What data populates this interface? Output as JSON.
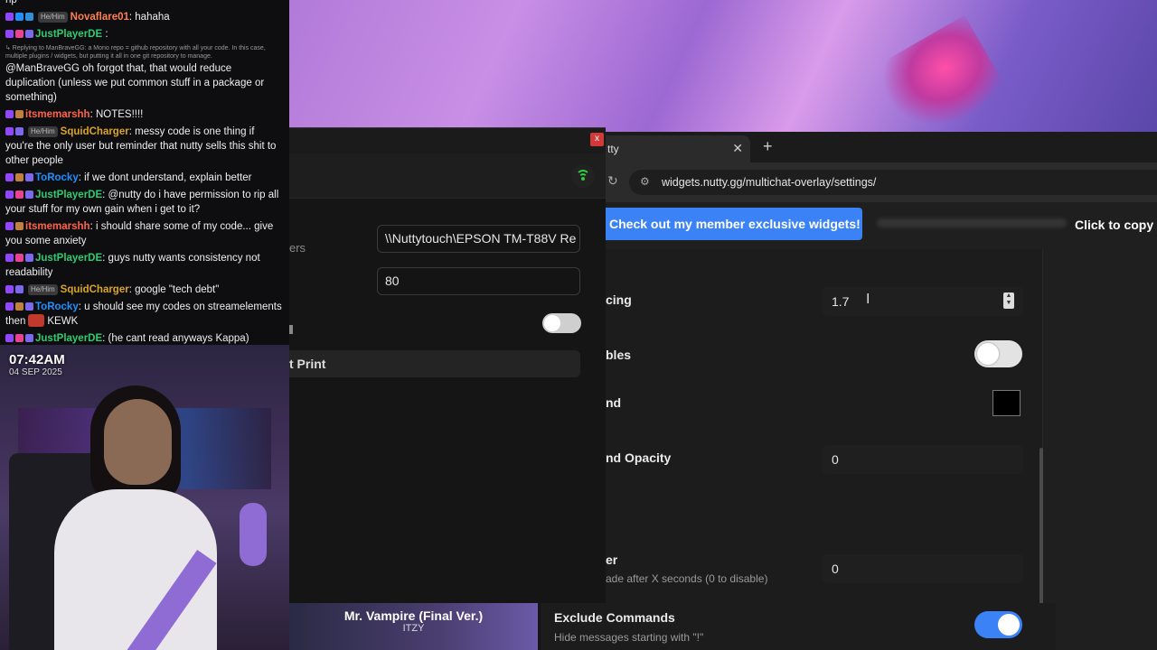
{
  "chat": {
    "messages": [
      {
        "user": "",
        "user_color": "#efeff1",
        "pronoun": "",
        "text": "rip",
        "reply": "",
        "badges": []
      },
      {
        "user": "Novaflare01",
        "user_color": "#ff7f50",
        "pronoun": "He/Him",
        "text": ": hahaha",
        "reply": "",
        "badges": [
          "#9146ff",
          "#1e90ff",
          "#2f8fd8"
        ]
      },
      {
        "user": "JustPlayerDE",
        "user_color": "#2ecc71",
        "pronoun": "",
        "text": " :",
        "reply": "",
        "badges": [
          "#9146ff",
          "#e84393",
          "#7b68ee"
        ]
      },
      {
        "user": "",
        "user_color": "#efeff1",
        "pronoun": "",
        "text": "@ManBraveGG oh forgot that, that would reduce duplication (unless we put common stuff in a package or something)",
        "reply": "↳ Replying to ManBraveGG: a Mono repo = github repository with all your code. In this case, multiple plugins / widgets, but putting it all in one git repository to manage.",
        "badges": []
      },
      {
        "user": "itsmemarshh",
        "user_color": "#ff6347",
        "pronoun": "",
        "text": ": NOTES!!!!",
        "reply": "",
        "badges": [
          "#9146ff",
          "#c08040"
        ]
      },
      {
        "user": "SquidCharger",
        "user_color": "#daa520",
        "pronoun": "He/Him",
        "text": ": messy code is one thing if you're the only user but reminder that nutty sells this shit to other people",
        "reply": "",
        "badges": [
          "#9146ff",
          "#7b68ee"
        ]
      },
      {
        "user": "ToRocky",
        "user_color": "#1e90ff",
        "pronoun": "",
        "text": ": if we dont understand, explain better",
        "reply": "",
        "badges": [
          "#9146ff",
          "#c08040",
          "#7b68ee"
        ]
      },
      {
        "user": "JustPlayerDE",
        "user_color": "#2ecc71",
        "pronoun": "",
        "text": ": @nutty do i have permission to rip all your stuff for my own gain when i get to it?",
        "reply": "",
        "badges": [
          "#9146ff",
          "#e84393",
          "#7b68ee"
        ]
      },
      {
        "user": "itsmemarshh",
        "user_color": "#ff6347",
        "pronoun": "",
        "text": ": i should share some of my code... give you some anxiety",
        "reply": "",
        "badges": [
          "#9146ff",
          "#c08040"
        ]
      },
      {
        "user": "JustPlayerDE",
        "user_color": "#2ecc71",
        "pronoun": "",
        "text": ": guys nutty wants consistency not readability",
        "reply": "",
        "badges": [
          "#9146ff",
          "#e84393",
          "#7b68ee"
        ]
      },
      {
        "user": "SquidCharger",
        "user_color": "#daa520",
        "pronoun": "He/Him",
        "text": ": google \"tech debt\"",
        "reply": "",
        "badges": [
          "#9146ff",
          "#7b68ee"
        ]
      },
      {
        "user": "ToRocky",
        "user_color": "#1e90ff",
        "pronoun": "",
        "text": ": u should see my codes on streamelements then",
        "reply": "",
        "badges": [
          "#9146ff",
          "#c08040",
          "#7b68ee"
        ],
        "trailing": "KEWK"
      },
      {
        "user": "JustPlayerDE",
        "user_color": "#2ecc71",
        "pronoun": "",
        "text": ": (he cant read anyways Kappa)",
        "reply": "",
        "badges": [
          "#9146ff",
          "#e84393",
          "#7b68ee"
        ]
      }
    ]
  },
  "webcam": {
    "time": "07:42AM",
    "date": "04 SEP 2025"
  },
  "print_window": {
    "close_label": "x",
    "label_printers": "ers",
    "printer_value": "\\\\Nuttytouch\\EPSON TM-T88V Re",
    "width_value": "80",
    "print_button": "t Print"
  },
  "browser": {
    "tab_title": "tty",
    "tab_close": "✕",
    "new_tab": "+",
    "url": "widgets.nutty.gg/multichat-overlay/settings/",
    "promo_button": "Check out my member exclusive widgets!",
    "copy_label": "Click to copy U",
    "settings": {
      "line_spacing_label": "cing",
      "line_spacing_value": "1.7",
      "bubbles_label": "bles",
      "background_label": "nd",
      "background_opacity_label": "nd Opacity",
      "background_opacity_value": "0",
      "fade_label": "er",
      "fade_sub": "ade after X seconds (0 to disable)",
      "fade_value": "0",
      "exclude_label": "Exclude Commands",
      "exclude_sub": "Hide messages starting with \"!\""
    }
  },
  "now_playing": {
    "song": "Mr. Vampire (Final Ver.)",
    "artist": "ITZY"
  }
}
